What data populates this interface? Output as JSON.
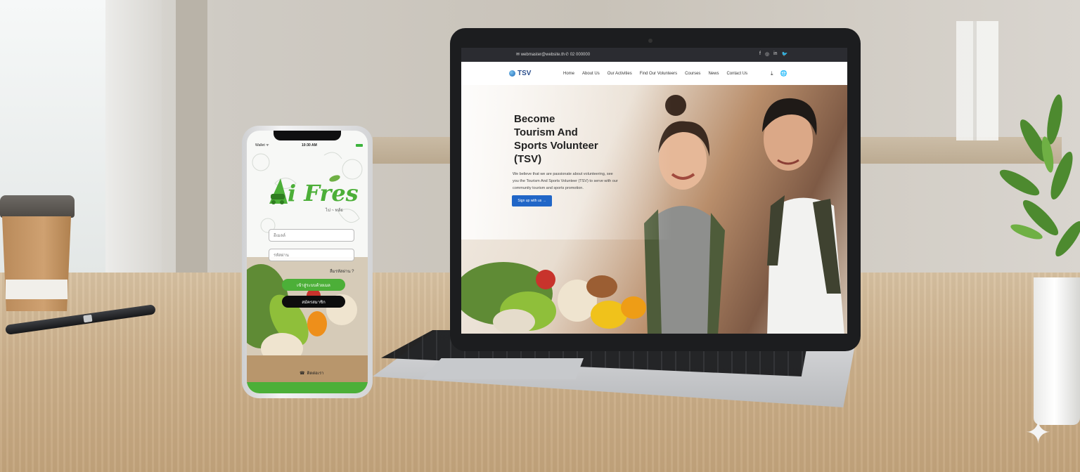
{
  "laptop_site": {
    "topbar": {
      "email": "✉ webmaster@website.th",
      "phone": "✆ 02 000000",
      "socials": [
        "f",
        "◎",
        "in",
        "🐦"
      ]
    },
    "logo": "TSV",
    "nav": [
      "Home",
      "About Us",
      "Our Activities",
      "Find Our Volunteers",
      "Courses",
      "News",
      "Contact Us"
    ],
    "nav_icons": [
      "⤓",
      "🌐"
    ],
    "hero": {
      "title": "Become\nTourism And\nSports Volunteer\n(TSV)",
      "body": "We believe that we are passionate about volunteering, see you the Tourism And Sports Volunteer (TSV) to serve with our community tourism and sports promotion.",
      "button": "Sign up with us →"
    }
  },
  "phone_app": {
    "status_left": "Wallet ᯤ",
    "status_time": "10:30 AM",
    "logo_text": "i Fresh",
    "logo_mark": "A",
    "subtitle": "ไป ~ ทส์ธ",
    "username_placeholder": "อีเมลล์",
    "password_placeholder": "รหัสผ่าน",
    "forgot": "ลืมรหัสผ่าน ?",
    "login_button": "เข้าสู่ระบบด้วยเมล",
    "register_button": "สมัครสมาชิก",
    "contact": "ติดต่อเรา"
  },
  "colors": {
    "accent_green": "#4caf38",
    "accent_blue": "#2166c7",
    "topbar": "#2b2c31"
  }
}
